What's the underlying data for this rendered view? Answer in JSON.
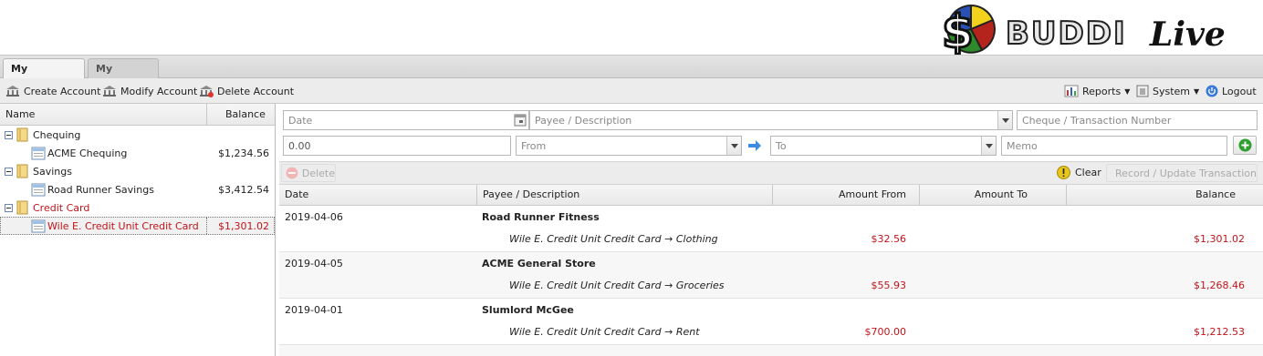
{
  "brand": {
    "name": "BUDDI",
    "suffix": "Live",
    "logo_text": "$"
  },
  "tabs": [
    {
      "label": "My Accounts",
      "active": true
    },
    {
      "label": "My Budget",
      "active": false
    }
  ],
  "toolbar": {
    "create_account": "Create Account",
    "modify_account": "Modify Account",
    "delete_account": "Delete Account",
    "reports": "Reports",
    "system": "System",
    "logout": "Logout"
  },
  "accounts_table": {
    "col_name": "Name",
    "col_balance": "Balance",
    "groups": [
      {
        "label": "Chequing",
        "color": "#222222",
        "accounts": [
          {
            "name": "ACME Chequing",
            "balance": "$1,234.56",
            "color": "#222222"
          }
        ]
      },
      {
        "label": "Savings",
        "color": "#222222",
        "accounts": [
          {
            "name": "Road Runner Savings",
            "balance": "$3,412.54",
            "color": "#222222"
          }
        ]
      },
      {
        "label": "Credit Card",
        "color": "#c0141a",
        "accounts": [
          {
            "name": "Wile E. Credit Unit Credit Card",
            "balance": "$1,301.02",
            "color": "#c0141a",
            "selected": true
          }
        ]
      }
    ]
  },
  "entry_form": {
    "date_placeholder": "Date",
    "payee_placeholder": "Payee / Description",
    "number_placeholder": "Cheque / Transaction Number",
    "amount_value": "0.00",
    "from_placeholder": "From",
    "to_placeholder": "To",
    "memo_placeholder": "Memo"
  },
  "actions": {
    "delete": "Delete",
    "clear": "Clear",
    "record": "Record / Update Transaction"
  },
  "transactions_table": {
    "headers": {
      "date": "Date",
      "payee": "Payee / Description",
      "amount_from": "Amount From",
      "amount_to": "Amount To",
      "balance": "Balance"
    },
    "rows": [
      {
        "date": "2019-04-06",
        "payee": "Road Runner Fitness",
        "memo": "Wile E. Credit Unit Credit Card → Clothing",
        "amount_from": "$32.56",
        "amount_to": "",
        "balance": "$1,301.02"
      },
      {
        "date": "2019-04-05",
        "payee": "ACME General Store",
        "memo": "Wile E. Credit Unit Credit Card → Groceries",
        "amount_from": "$55.93",
        "amount_to": "",
        "balance": "$1,268.46"
      },
      {
        "date": "2019-04-01",
        "payee": "Slumlord McGee",
        "memo": "Wile E. Credit Unit Credit Card → Rent",
        "amount_from": "$700.00",
        "amount_to": "",
        "balance": "$1,212.53"
      }
    ]
  },
  "colors": {
    "accent_red": "#c0141a",
    "selected_row_bg": "#f1f1f1"
  }
}
